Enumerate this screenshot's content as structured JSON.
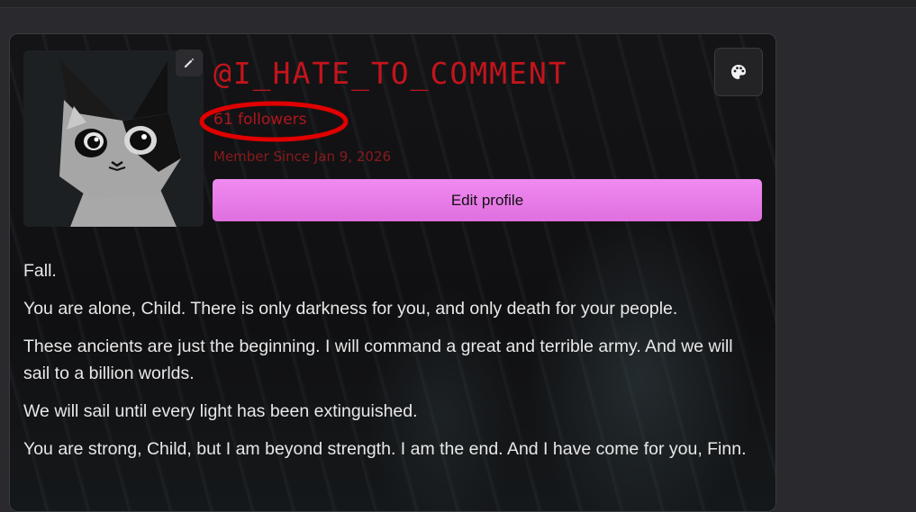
{
  "profile": {
    "username": "@I_HATE_TO_COMMENT",
    "followers": "61 followers",
    "member_since": "Member Since Jan 9, 2026",
    "edit_profile_label": "Edit profile",
    "avatar_edit_icon": "pencil-icon",
    "theme_icon": "palette-icon"
  },
  "colors": {
    "username": "#c4141c",
    "followers": "#b1161c",
    "member_since": "#8a1a1c",
    "edit_button": "#e97ae9",
    "highlight_circle": "#e00000"
  },
  "bio": {
    "paragraphs": [
      "Fall.",
      "You are alone, Child. There is only darkness for you, and only death for your people.",
      "These ancients are just the beginning. I will command a great and terrible army. And we will sail to a billion worlds.",
      "We will sail until every light has been extinguished.",
      "You are strong, Child, but I am beyond strength. I am the end. And I have come for you, Finn."
    ]
  }
}
